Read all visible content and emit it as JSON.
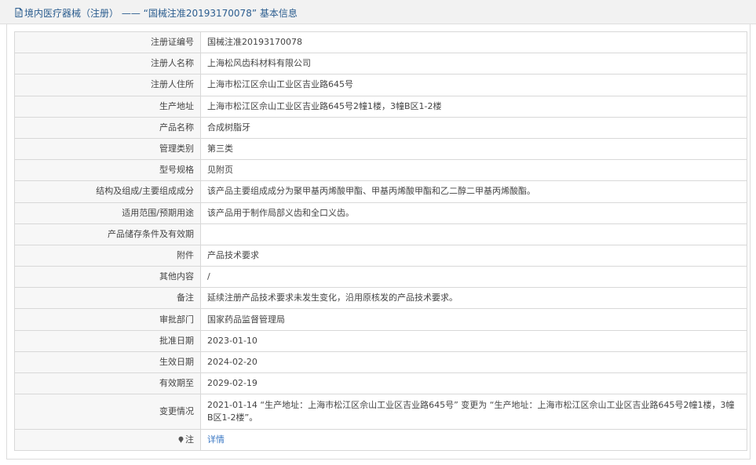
{
  "header": {
    "icon": "document-icon",
    "title": "境内医疗器械（注册） ——  “国械注准20193170078” 基本信息"
  },
  "rows": [
    {
      "label": "注册证编号",
      "value": "国械注准20193170078"
    },
    {
      "label": "注册人名称",
      "value": "上海松风齿科材料有限公司"
    },
    {
      "label": "注册人住所",
      "value": "上海市松江区佘山工业区吉业路645号"
    },
    {
      "label": "生产地址",
      "value": "上海市松江区佘山工业区吉业路645号2幢1楼，3幢B区1-2楼"
    },
    {
      "label": "产品名称",
      "value": "合成树脂牙"
    },
    {
      "label": "管理类别",
      "value": "第三类"
    },
    {
      "label": "型号规格",
      "value": "见附页"
    },
    {
      "label": "结构及组成/主要组成成分",
      "value": "该产品主要组成成分为聚甲基丙烯酸甲酯、甲基丙烯酸甲酯和乙二醇二甲基丙烯酸酯。"
    },
    {
      "label": "适用范围/预期用途",
      "value": "该产品用于制作局部义齿和全口义齿。"
    },
    {
      "label": "产品储存条件及有效期",
      "value": ""
    },
    {
      "label": "附件",
      "value": "产品技术要求"
    },
    {
      "label": "其他内容",
      "value": "/"
    },
    {
      "label": "备注",
      "value": "延续注册产品技术要求未发生变化，沿用原核发的产品技术要求。"
    },
    {
      "label": "审批部门",
      "value": "国家药品监督管理局"
    },
    {
      "label": "批准日期",
      "value": "2023-01-10"
    },
    {
      "label": "生效日期",
      "value": "2024-02-20"
    },
    {
      "label": "有效期至",
      "value": "2029-02-19"
    },
    {
      "label": "变更情况",
      "value": "2021-01-14  “生产地址：上海市松江区佘山工业区吉业路645号” 变更为 “生产地址：上海市松江区佘山工业区吉业路645号2幢1楼，3幢B区1-2楼”。"
    }
  ],
  "note": {
    "icon": "pin-icon",
    "label": "注",
    "link": "详情"
  },
  "colors": {
    "link": "#3b78c4",
    "title": "#2b5d8f",
    "label_bg": "#f7f7f7",
    "border": "#d8d8d8"
  }
}
